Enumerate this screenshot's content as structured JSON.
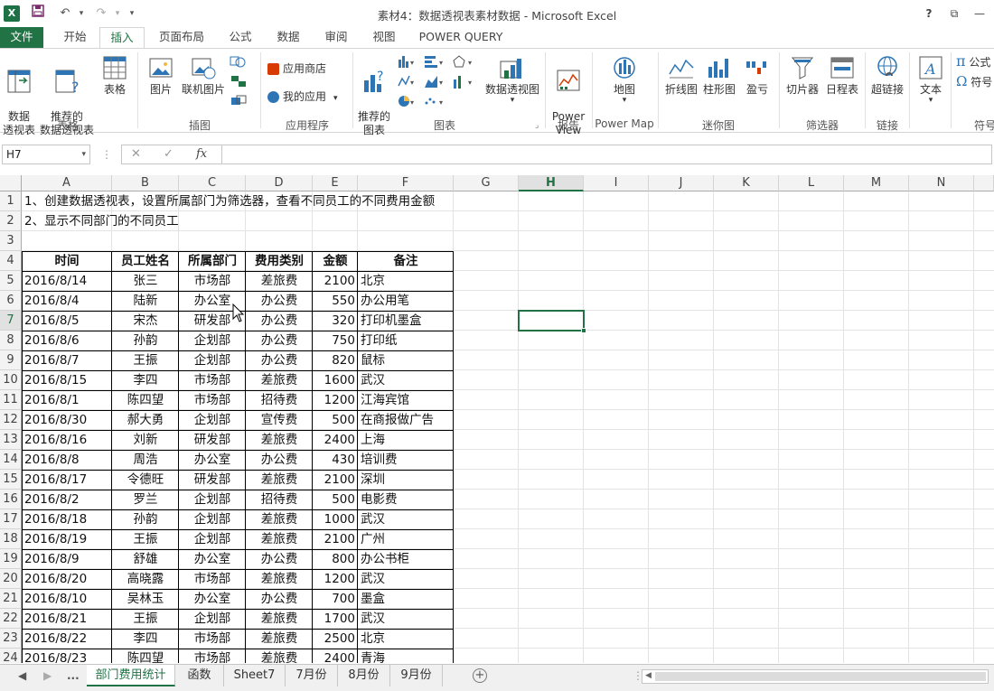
{
  "window": {
    "title": "素材4：数据透视表素材数据 - Microsoft Excel",
    "help": "?",
    "restore": "⧉",
    "minimize": "—"
  },
  "qat": {
    "undo": "↶",
    "redo": "↷",
    "customize": "▾"
  },
  "tabs": [
    "文件",
    "开始",
    "插入",
    "页面布局",
    "公式",
    "数据",
    "审阅",
    "视图",
    "POWER QUERY"
  ],
  "ribbon": {
    "pivot_table": "数据\n透视表",
    "recommended_pivot": "推荐的\n数据透视表",
    "table": "表格",
    "group_tables": "表格",
    "picture": "图片",
    "online_picture": "联机图片",
    "group_illustrations": "插图",
    "app_store": "应用商店",
    "my_apps": "我的应用",
    "group_apps": "应用程序",
    "recommended_charts": "推荐的\n图表",
    "pivot_chart": "数据透视图",
    "group_charts": "图表",
    "power_view": "Power\nView",
    "group_reports": "报告",
    "map": "地图",
    "group_powermap": "Power Map",
    "spark_line": "折线图",
    "spark_column": "柱形图",
    "spark_winloss": "盈亏",
    "group_sparklines": "迷你图",
    "slicer": "切片器",
    "timeline": "日程表",
    "group_filters": "筛选器",
    "hyperlink": "超链接",
    "group_links": "链接",
    "text": "文本",
    "formula": "公式",
    "symbol": "符号",
    "group_symbols": "符号",
    "colors": {
      "accent": "#217346",
      "app_store_red": "#d83b01",
      "blue": "#2e75b6"
    }
  },
  "formula_bar": {
    "name_box": "H7",
    "fx": "fx",
    "cancel": "✕",
    "confirm": "✓",
    "value": ""
  },
  "columns": [
    "A",
    "B",
    "C",
    "D",
    "E",
    "F",
    "G",
    "H",
    "I",
    "J",
    "K",
    "L",
    "M",
    "N"
  ],
  "selected_column": "H",
  "selected_row": 7,
  "notes": [
    "1、创建数据透视表，设置所属部门为筛选器，查看不同员工的不同费用金额",
    "2、显示不同部门的不同员工"
  ],
  "table": {
    "headers": [
      "时间",
      "员工姓名",
      "所属部门",
      "费用类别",
      "金额",
      "备注"
    ],
    "rows": [
      [
        "2016/8/14",
        "张三",
        "市场部",
        "差旅费",
        "2100",
        "北京"
      ],
      [
        "2016/8/4",
        "陆新",
        "办公室",
        "办公费",
        "550",
        "办公用笔"
      ],
      [
        "2016/8/5",
        "宋杰",
        "研发部",
        "办公费",
        "320",
        "打印机墨盒"
      ],
      [
        "2016/8/6",
        "孙韵",
        "企划部",
        "办公费",
        "750",
        "打印纸"
      ],
      [
        "2016/8/7",
        "王振",
        "企划部",
        "办公费",
        "820",
        "鼠标"
      ],
      [
        "2016/8/15",
        "李四",
        "市场部",
        "差旅费",
        "1600",
        "武汉"
      ],
      [
        "2016/8/1",
        "陈四望",
        "市场部",
        "招待费",
        "1200",
        "江海宾馆"
      ],
      [
        "2016/8/30",
        "郝大勇",
        "企划部",
        "宣传费",
        "500",
        "在商报做广告"
      ],
      [
        "2016/8/16",
        "刘新",
        "研发部",
        "差旅费",
        "2400",
        "上海"
      ],
      [
        "2016/8/8",
        "周浩",
        "办公室",
        "办公费",
        "430",
        "培训费"
      ],
      [
        "2016/8/17",
        "令德旺",
        "研发部",
        "差旅费",
        "2100",
        "深圳"
      ],
      [
        "2016/8/2",
        "罗兰",
        "企划部",
        "招待费",
        "500",
        "电影费"
      ],
      [
        "2016/8/18",
        "孙韵",
        "企划部",
        "差旅费",
        "1000",
        "武汉"
      ],
      [
        "2016/8/19",
        "王振",
        "企划部",
        "差旅费",
        "2100",
        "广州"
      ],
      [
        "2016/8/9",
        "舒雄",
        "办公室",
        "办公费",
        "800",
        "办公书柜"
      ],
      [
        "2016/8/20",
        "高晓露",
        "市场部",
        "差旅费",
        "1200",
        "武汉"
      ],
      [
        "2016/8/10",
        "吴林玉",
        "办公室",
        "办公费",
        "700",
        "墨盒"
      ],
      [
        "2016/8/21",
        "王振",
        "企划部",
        "差旅费",
        "1700",
        "武汉"
      ],
      [
        "2016/8/22",
        "李四",
        "市场部",
        "差旅费",
        "2500",
        "北京"
      ],
      [
        "2016/8/23",
        "陈四望",
        "市场部",
        "差旅费",
        "2400",
        "青海"
      ]
    ]
  },
  "sheets": {
    "ellipsis": "...",
    "nav_prev": "◀",
    "nav_next": "▶",
    "tabs": [
      "部门费用统计",
      "函数",
      "Sheet7",
      "7月份",
      "8月份",
      "9月份"
    ],
    "active": "部门费用统计",
    "add": "+"
  }
}
